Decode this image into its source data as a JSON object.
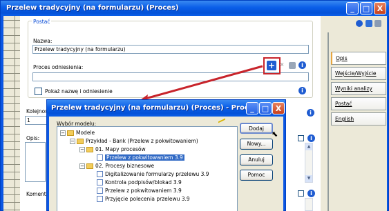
{
  "window": {
    "title": "Przelew tradycyjny (na formularzu) (Proces)",
    "buttons": [
      "_",
      "□",
      "X"
    ]
  },
  "form": {
    "group_label": "Postać",
    "name_label": "Nazwa:",
    "name_value": "Przelew tradycyjny (na formularzu)",
    "ref_label": "Proces odniesienia:",
    "ref_value": "",
    "show_label": "Pokaż nazwę i odniesienie",
    "order_label": "Kolejnoś",
    "order_value": "1",
    "description_label": "Opis:",
    "comment_label": "Komenta"
  },
  "tabs": [
    {
      "label": "Opis",
      "active": true
    },
    {
      "label": "Wejście/Wyjście",
      "active": false
    },
    {
      "label": "Wyniki analizy",
      "active": false
    },
    {
      "label": "Postać",
      "active": false
    },
    {
      "label": "English",
      "active": false
    }
  ],
  "dialog": {
    "title": "Przelew tradycyjny (na formularzu) (Proces) - Proce...",
    "model_label": "Wybór modelu:",
    "buttons": {
      "add": "Dodaj",
      "new": "Nowy...",
      "cancel": "Anuluj",
      "help": "Pomoc"
    },
    "tree": [
      {
        "label": "Modele",
        "level": 0,
        "kind": "folder",
        "expander": "−"
      },
      {
        "label": "Przykład - Bank (Przelew z pokwitowaniem)",
        "level": 1,
        "kind": "folder",
        "expander": "−"
      },
      {
        "label": "01. Mapy procesów",
        "level": 2,
        "kind": "folder",
        "expander": "−"
      },
      {
        "label": "Przelew z pokwitowaniem 3.9",
        "level": 3,
        "kind": "doc",
        "selected": true
      },
      {
        "label": "02. Procesy biznesowe",
        "level": 2,
        "kind": "folder",
        "expander": "−"
      },
      {
        "label": "Digitalizowanie formularzy przelewu 3.9",
        "level": 3,
        "kind": "doc"
      },
      {
        "label": "Kontrola podpisów/blokad 3.9",
        "level": 3,
        "kind": "doc"
      },
      {
        "label": "Przelew z pokwitowaniem 3.9",
        "level": 3,
        "kind": "doc"
      },
      {
        "label": "Przyjęcie polecenia przelewu 3.9",
        "level": 3,
        "kind": "doc"
      }
    ]
  },
  "colors": {
    "titlebar": "#0a5ee8",
    "highlight": "#c8242b",
    "selection": "#316ac5"
  },
  "icons": [
    "info-icon",
    "add-icon",
    "delete-icon",
    "save-icon",
    "print-icon",
    "folder-icon",
    "model-icon",
    "filter-icon"
  ]
}
